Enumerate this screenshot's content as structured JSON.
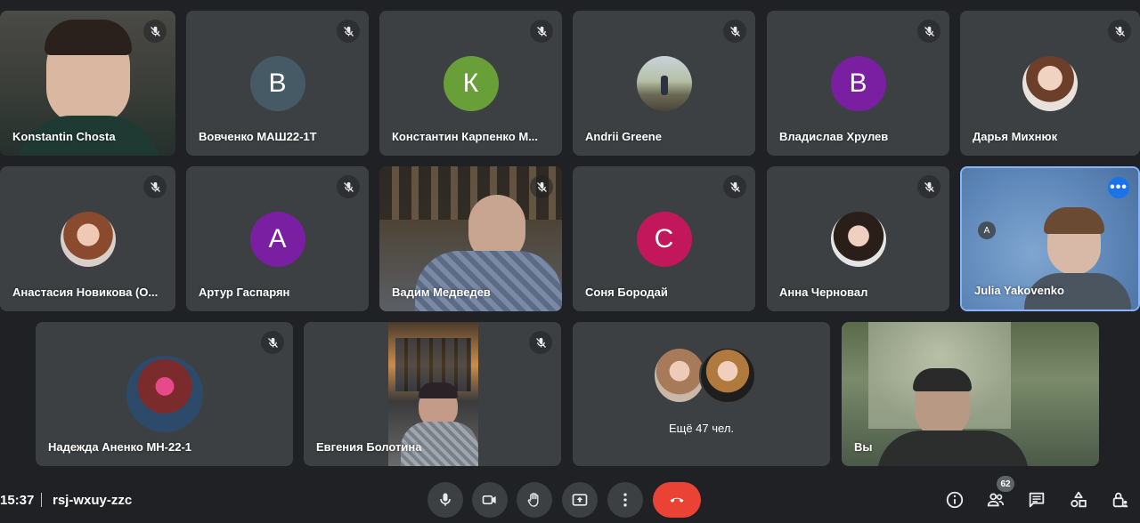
{
  "participants": [
    {
      "name": "Konstantin Chosta"
    },
    {
      "name": "Вовченко МАШ22-1Т",
      "initial": "В"
    },
    {
      "name": "Константин Карпенко М...",
      "initial": "К"
    },
    {
      "name": "Andrii Greene"
    },
    {
      "name": "Владислав Хрулев",
      "initial": "В"
    },
    {
      "name": "Дарья Михнюк"
    },
    {
      "name": "Анастасия Новикова (О..."
    },
    {
      "name": "Артур Гаспарян",
      "initial": "А"
    },
    {
      "name": "Вадим Медведев"
    },
    {
      "name": "Соня Бородай",
      "initial": "С"
    },
    {
      "name": "Анна Черновал"
    },
    {
      "name": "Julia Yakovenko",
      "initial": "A"
    },
    {
      "name": "Надежда Аненко МН-22-1"
    },
    {
      "name": "Евгения Болотина"
    },
    {
      "name": "Вы"
    }
  ],
  "others": {
    "label": "Ещё 47 чел."
  },
  "more_options_glyph": "•••",
  "bottom_bar": {
    "time": "15:37",
    "meeting_code": "rsj-wxuy-zzc",
    "people_count": "62"
  },
  "colors": {
    "background": "#202124",
    "tile": "#3c4043",
    "avatar_slate": "#455a64",
    "avatar_green": "#689f38",
    "avatar_purple": "#7b1fa2",
    "avatar_magenta": "#c2185b",
    "end_call": "#ea4335",
    "active_border": "#8ab4f8"
  }
}
